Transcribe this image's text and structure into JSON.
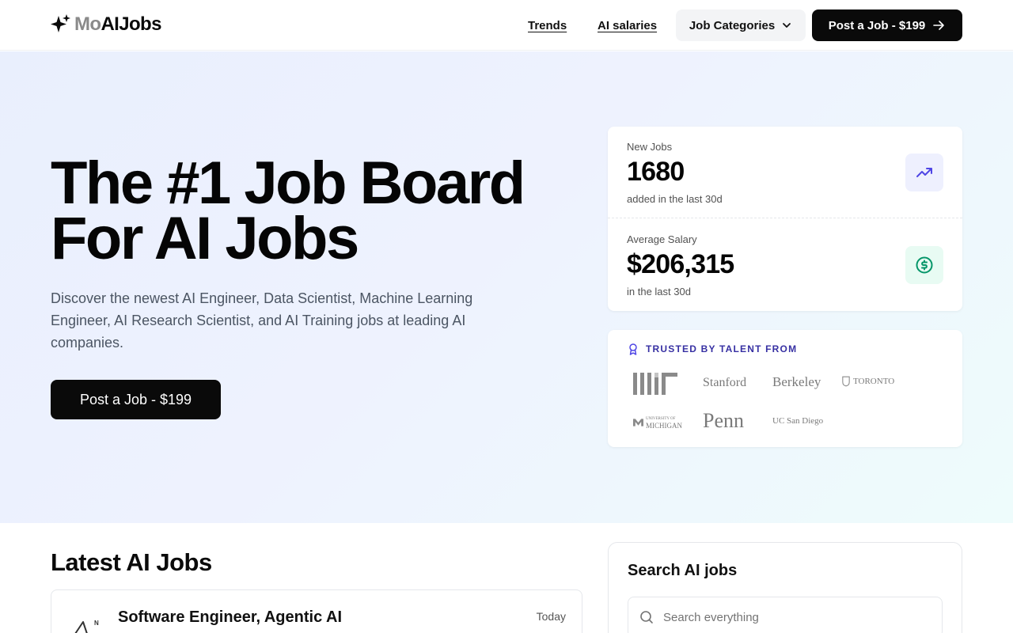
{
  "header": {
    "logo_mo": "Mo",
    "logo_ai": "AIJobs",
    "nav": {
      "trends": "Trends",
      "salaries": "AI salaries"
    },
    "categories_label": "Job Categories",
    "post_label": "Post a Job - $199"
  },
  "hero": {
    "title_line1": "The #1 Job Board",
    "title_line2": "For AI Jobs",
    "description": "Discover the newest AI Engineer, Data Scientist, Machine Learning Engineer, AI Research Scientist, and AI Training jobs at leading AI companies.",
    "post_label": "Post a Job - $199"
  },
  "stats": {
    "new_jobs": {
      "label": "New Jobs",
      "value": "1680",
      "sub": "added in the last 30d",
      "icon": "trending-up-icon"
    },
    "avg_salary": {
      "label": "Average Salary",
      "value": "$206,315",
      "sub": "in the last 30d",
      "icon": "dollar-icon"
    }
  },
  "trusted": {
    "title": "TRUSTED BY TALENT FROM",
    "stanford": "Stanford",
    "berkeley": "Berkeley",
    "toronto": "TORONTO",
    "michigan_top": "UNIVERSITY OF",
    "michigan": "MICHIGAN",
    "penn": "Penn",
    "ucsd": "UC San Diego"
  },
  "latest": {
    "title": "Latest AI Jobs",
    "jobs": [
      {
        "title": "Software Engineer, Agentic AI",
        "date": "Today"
      }
    ]
  },
  "search": {
    "title": "Search AI jobs",
    "placeholder": "Search everything"
  },
  "colors": {
    "accent_purple": "#4f46e5",
    "accent_green": "#059669",
    "trust_title": "#3730a3"
  }
}
